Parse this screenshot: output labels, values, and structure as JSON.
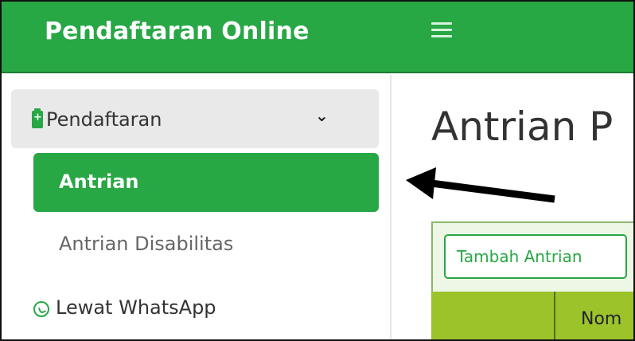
{
  "header": {
    "brand": "Pendaftaran Online",
    "menu_icon": "hamburger-icon"
  },
  "sidebar": {
    "parent": {
      "label": "Pendaftaran",
      "icon": "clipboard-plus-icon",
      "chevron": "chevron-down-icon"
    },
    "items": [
      {
        "label": "Antrian",
        "active": true
      },
      {
        "label": "Antrian Disabilitas",
        "active": false
      }
    ],
    "whatsapp": {
      "label": "Lewat WhatsApp",
      "icon": "whatsapp-icon"
    }
  },
  "main": {
    "title": "Antrian P",
    "add_button": "Tambah Antrian",
    "table_header_partial": "Nom"
  },
  "colors": {
    "primary": "#28a745",
    "table_header": "#9cc42a",
    "card_bg": "#eef7e6"
  }
}
